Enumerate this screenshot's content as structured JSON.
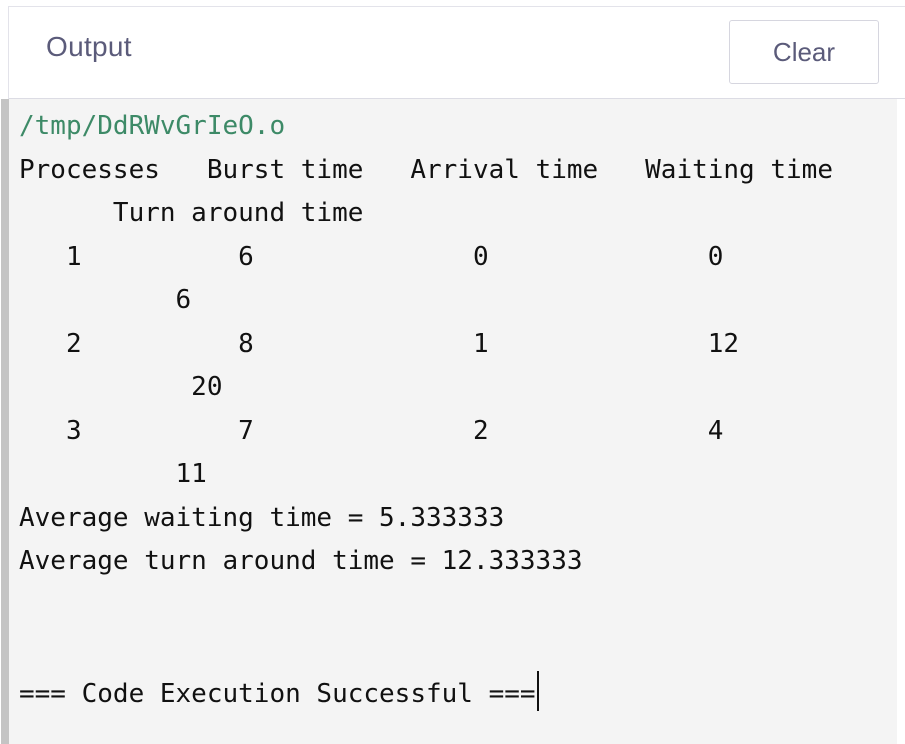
{
  "header": {
    "title": "Output",
    "clear_label": "Clear"
  },
  "console": {
    "path": "/tmp/DdRWvGrIeO.o",
    "lines": [
      "Processes   Burst time   Arrival time   Waiting time",
      "      Turn around time",
      "   1          6              0              0",
      "          6",
      "   2          8              1              12",
      "           20",
      "   3          7              2              4",
      "          11",
      "Average waiting time = 5.333333",
      "Average turn around time = 12.333333",
      "",
      "",
      "=== Code Execution Successful ==="
    ]
  },
  "colors": {
    "path_text": "#3d8a67",
    "console_bg": "#f4f4f4",
    "title_text": "#5b5b7a"
  }
}
